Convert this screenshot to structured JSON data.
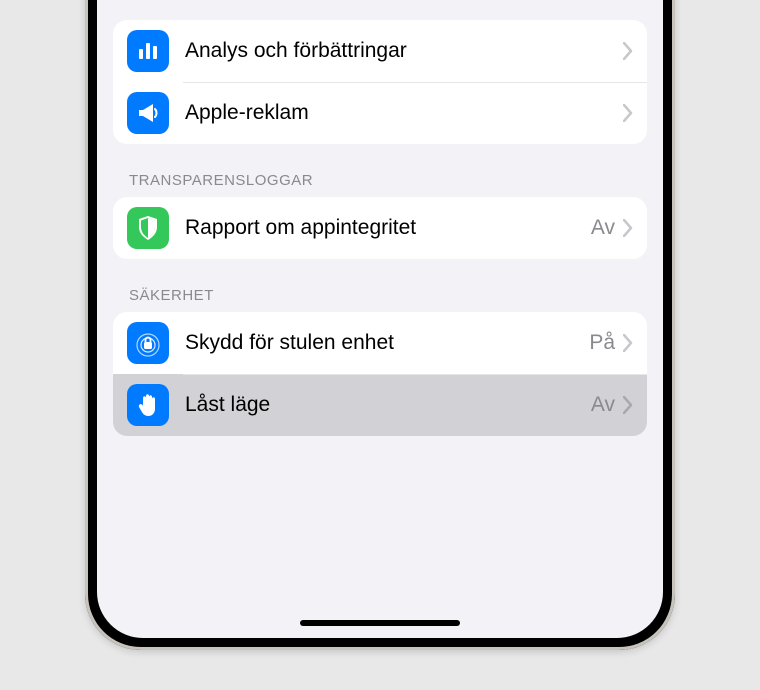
{
  "group1": {
    "items": [
      {
        "label": "Analys och förbättringar",
        "icon": "bars-icon"
      },
      {
        "label": "Apple-reklam",
        "icon": "megaphone-icon"
      }
    ]
  },
  "section_transparency": {
    "header": "Transparensloggar",
    "items": [
      {
        "label": "Rapport om appintegritet",
        "value": "Av",
        "icon": "shield-icon"
      }
    ]
  },
  "section_security": {
    "header": "Säkerhet",
    "items": [
      {
        "label": "Skydd för stulen enhet",
        "value": "På",
        "icon": "lock-ripple-icon"
      },
      {
        "label": "Låst läge",
        "value": "Av",
        "icon": "hand-icon"
      }
    ]
  }
}
